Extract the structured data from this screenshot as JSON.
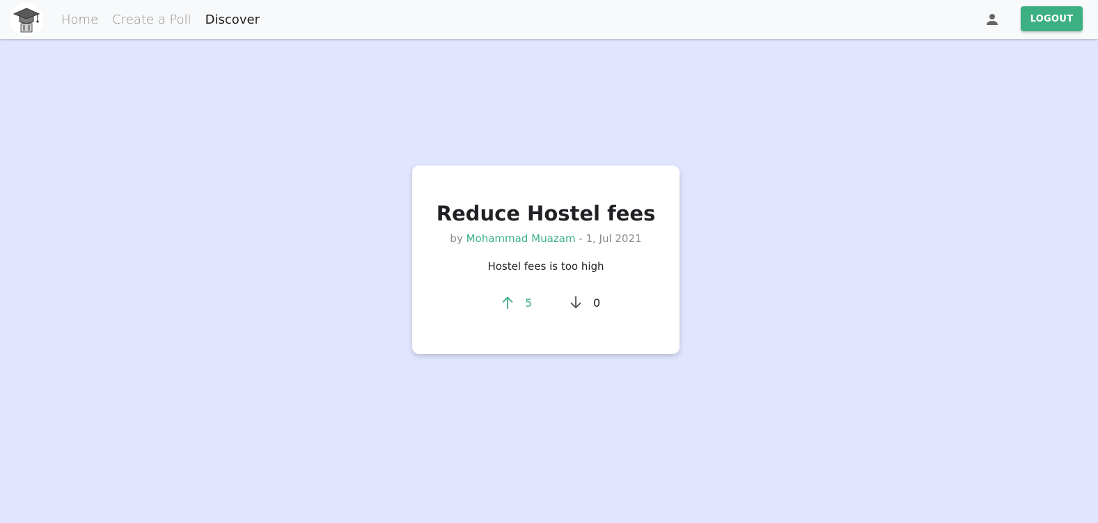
{
  "nav": {
    "logo_icon": "graduation-cap-icon",
    "links": [
      {
        "label": "Home"
      },
      {
        "label": "Create a Poll"
      },
      {
        "label": "Discover"
      }
    ],
    "active_link": "Discover",
    "user_icon": "person-icon",
    "logout_label": "LOGOUT"
  },
  "poll": {
    "title": "Reduce Hostel fees",
    "by_prefix": "by",
    "author": "Mohammad Muazam",
    "date_separator": "-",
    "date": "1, Jul 2021",
    "description": "Hostel fees is too high",
    "upvotes": "5",
    "downvotes": "0",
    "upvote_icon": "arrow-up-icon",
    "downvote_icon": "arrow-down-icon"
  },
  "colors": {
    "accent": "#3cb083",
    "background": "#e1e6fe",
    "navbar": "#f8f9fa"
  }
}
